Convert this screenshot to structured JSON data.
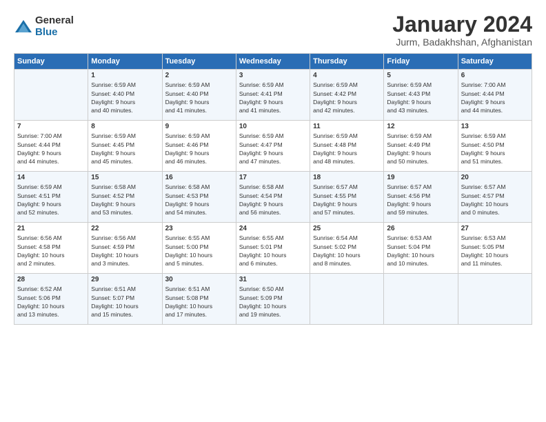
{
  "logo": {
    "general": "General",
    "blue": "Blue"
  },
  "calendar": {
    "title": "January 2024",
    "subtitle": "Jurm, Badakhshan, Afghanistan"
  },
  "headers": [
    "Sunday",
    "Monday",
    "Tuesday",
    "Wednesday",
    "Thursday",
    "Friday",
    "Saturday"
  ],
  "weeks": [
    [
      {
        "day": "",
        "info": ""
      },
      {
        "day": "1",
        "info": "Sunrise: 6:59 AM\nSunset: 4:40 PM\nDaylight: 9 hours\nand 40 minutes."
      },
      {
        "day": "2",
        "info": "Sunrise: 6:59 AM\nSunset: 4:40 PM\nDaylight: 9 hours\nand 41 minutes."
      },
      {
        "day": "3",
        "info": "Sunrise: 6:59 AM\nSunset: 4:41 PM\nDaylight: 9 hours\nand 41 minutes."
      },
      {
        "day": "4",
        "info": "Sunrise: 6:59 AM\nSunset: 4:42 PM\nDaylight: 9 hours\nand 42 minutes."
      },
      {
        "day": "5",
        "info": "Sunrise: 6:59 AM\nSunset: 4:43 PM\nDaylight: 9 hours\nand 43 minutes."
      },
      {
        "day": "6",
        "info": "Sunrise: 7:00 AM\nSunset: 4:44 PM\nDaylight: 9 hours\nand 44 minutes."
      }
    ],
    [
      {
        "day": "7",
        "info": "Sunrise: 7:00 AM\nSunset: 4:44 PM\nDaylight: 9 hours\nand 44 minutes."
      },
      {
        "day": "8",
        "info": "Sunrise: 6:59 AM\nSunset: 4:45 PM\nDaylight: 9 hours\nand 45 minutes."
      },
      {
        "day": "9",
        "info": "Sunrise: 6:59 AM\nSunset: 4:46 PM\nDaylight: 9 hours\nand 46 minutes."
      },
      {
        "day": "10",
        "info": "Sunrise: 6:59 AM\nSunset: 4:47 PM\nDaylight: 9 hours\nand 47 minutes."
      },
      {
        "day": "11",
        "info": "Sunrise: 6:59 AM\nSunset: 4:48 PM\nDaylight: 9 hours\nand 48 minutes."
      },
      {
        "day": "12",
        "info": "Sunrise: 6:59 AM\nSunset: 4:49 PM\nDaylight: 9 hours\nand 50 minutes."
      },
      {
        "day": "13",
        "info": "Sunrise: 6:59 AM\nSunset: 4:50 PM\nDaylight: 9 hours\nand 51 minutes."
      }
    ],
    [
      {
        "day": "14",
        "info": "Sunrise: 6:59 AM\nSunset: 4:51 PM\nDaylight: 9 hours\nand 52 minutes."
      },
      {
        "day": "15",
        "info": "Sunrise: 6:58 AM\nSunset: 4:52 PM\nDaylight: 9 hours\nand 53 minutes."
      },
      {
        "day": "16",
        "info": "Sunrise: 6:58 AM\nSunset: 4:53 PM\nDaylight: 9 hours\nand 54 minutes."
      },
      {
        "day": "17",
        "info": "Sunrise: 6:58 AM\nSunset: 4:54 PM\nDaylight: 9 hours\nand 56 minutes."
      },
      {
        "day": "18",
        "info": "Sunrise: 6:57 AM\nSunset: 4:55 PM\nDaylight: 9 hours\nand 57 minutes."
      },
      {
        "day": "19",
        "info": "Sunrise: 6:57 AM\nSunset: 4:56 PM\nDaylight: 9 hours\nand 59 minutes."
      },
      {
        "day": "20",
        "info": "Sunrise: 6:57 AM\nSunset: 4:57 PM\nDaylight: 10 hours\nand 0 minutes."
      }
    ],
    [
      {
        "day": "21",
        "info": "Sunrise: 6:56 AM\nSunset: 4:58 PM\nDaylight: 10 hours\nand 2 minutes."
      },
      {
        "day": "22",
        "info": "Sunrise: 6:56 AM\nSunset: 4:59 PM\nDaylight: 10 hours\nand 3 minutes."
      },
      {
        "day": "23",
        "info": "Sunrise: 6:55 AM\nSunset: 5:00 PM\nDaylight: 10 hours\nand 5 minutes."
      },
      {
        "day": "24",
        "info": "Sunrise: 6:55 AM\nSunset: 5:01 PM\nDaylight: 10 hours\nand 6 minutes."
      },
      {
        "day": "25",
        "info": "Sunrise: 6:54 AM\nSunset: 5:02 PM\nDaylight: 10 hours\nand 8 minutes."
      },
      {
        "day": "26",
        "info": "Sunrise: 6:53 AM\nSunset: 5:04 PM\nDaylight: 10 hours\nand 10 minutes."
      },
      {
        "day": "27",
        "info": "Sunrise: 6:53 AM\nSunset: 5:05 PM\nDaylight: 10 hours\nand 11 minutes."
      }
    ],
    [
      {
        "day": "28",
        "info": "Sunrise: 6:52 AM\nSunset: 5:06 PM\nDaylight: 10 hours\nand 13 minutes."
      },
      {
        "day": "29",
        "info": "Sunrise: 6:51 AM\nSunset: 5:07 PM\nDaylight: 10 hours\nand 15 minutes."
      },
      {
        "day": "30",
        "info": "Sunrise: 6:51 AM\nSunset: 5:08 PM\nDaylight: 10 hours\nand 17 minutes."
      },
      {
        "day": "31",
        "info": "Sunrise: 6:50 AM\nSunset: 5:09 PM\nDaylight: 10 hours\nand 19 minutes."
      },
      {
        "day": "",
        "info": ""
      },
      {
        "day": "",
        "info": ""
      },
      {
        "day": "",
        "info": ""
      }
    ]
  ]
}
